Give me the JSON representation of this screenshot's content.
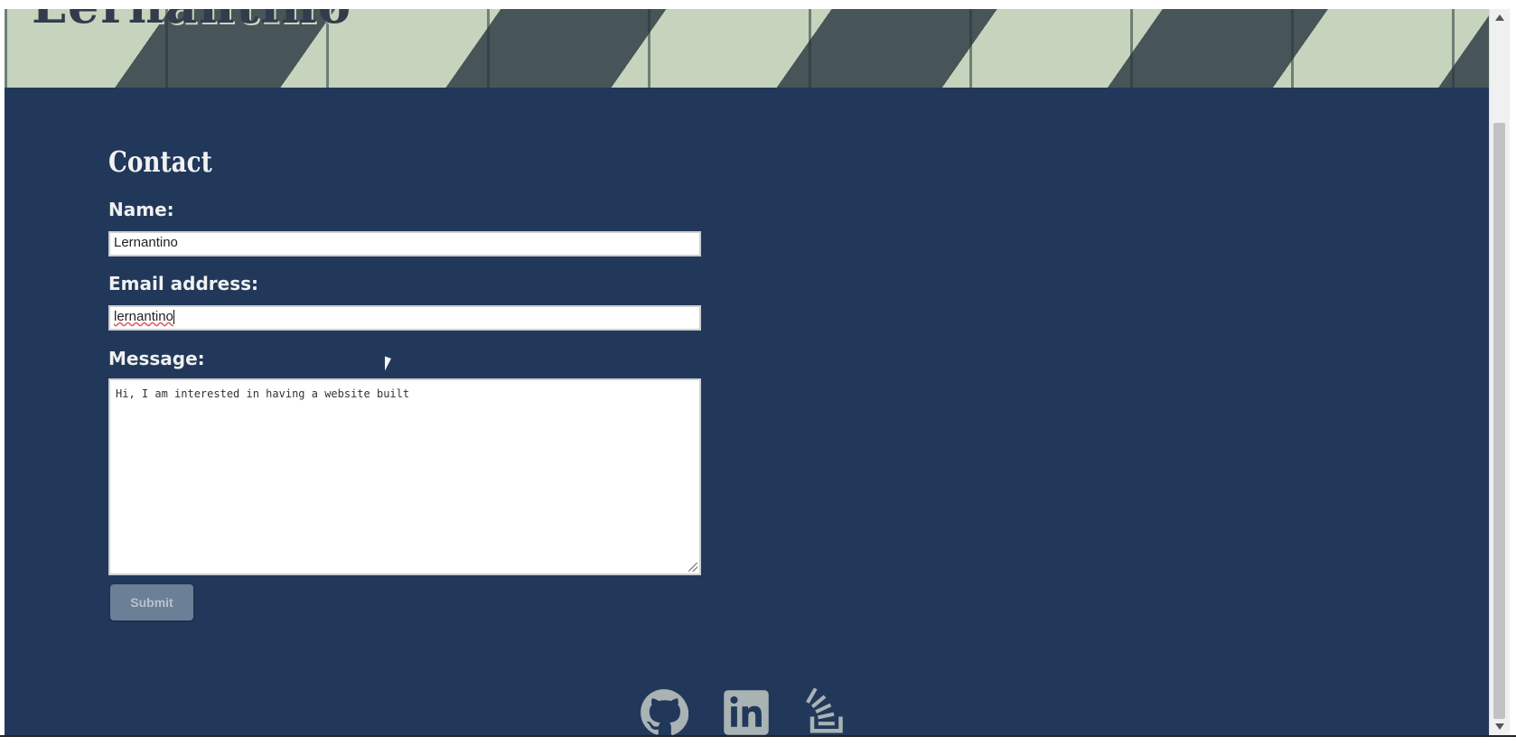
{
  "header": {
    "logo_text": "Lernantino"
  },
  "contact": {
    "title": "Contact",
    "name_label": "Name:",
    "name_value": "Lernantino",
    "email_label": "Email address:",
    "email_value": "lernantino",
    "message_label": "Message:",
    "message_value": "Hi, I am interested in having a website built",
    "submit_label": "Submit"
  },
  "social": {
    "icons": [
      "github-icon",
      "linkedin-icon",
      "stackoverflow-icon"
    ],
    "icon_color": "#a9b3b3"
  },
  "colors": {
    "background": "#21385a",
    "banner_light": "#c6d4bd",
    "banner_dark": "#475458",
    "button": "#6b7f97"
  }
}
